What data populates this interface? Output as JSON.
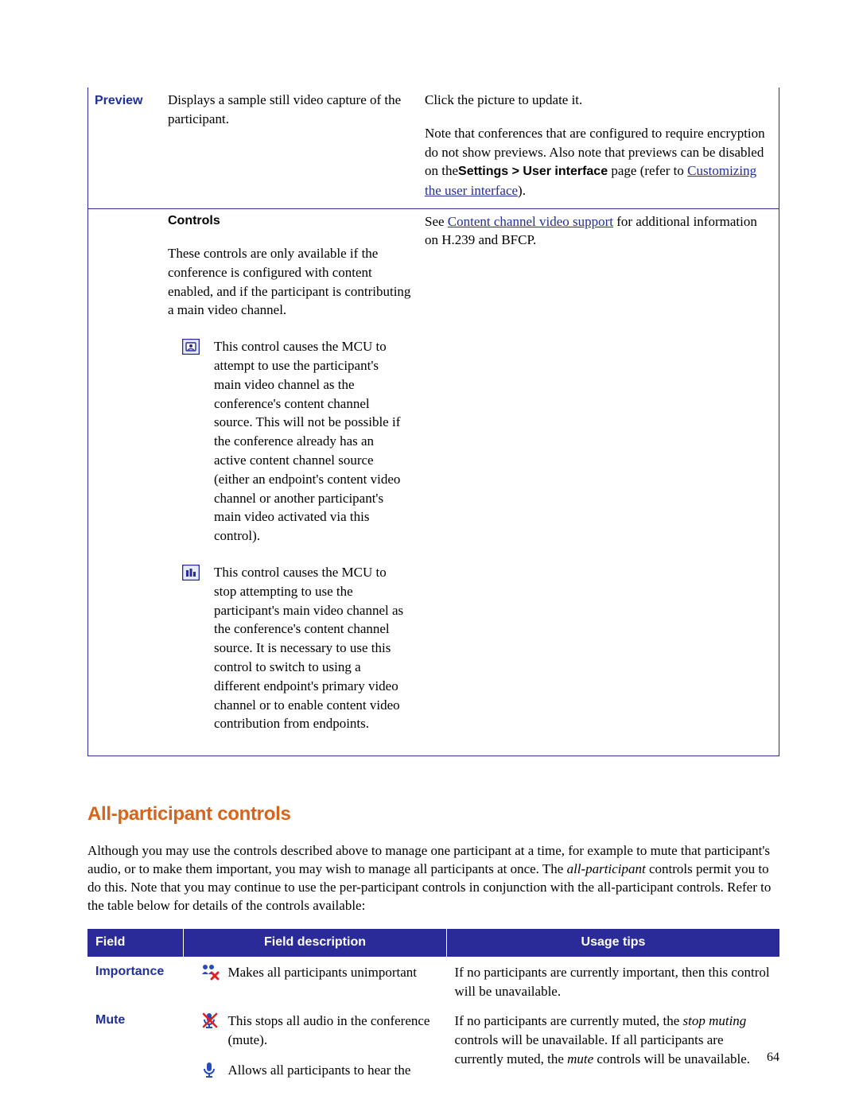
{
  "table1": {
    "preview": {
      "label": "Preview",
      "desc": "Displays a sample still video capture of the participant.",
      "tip1": "Click the picture to update it.",
      "tip2a": "Note that conferences that are configured to require encryption do not show previews. Also note that previews can be disabled on the",
      "tip2b": "Settings > User interface",
      "tip2c": " page (refer to ",
      "tip_link": "Customizing the user interface",
      "tip2d": ")."
    },
    "controls": {
      "label": "Controls",
      "desc": "These controls are only available if the conference is configured with content enabled, and if the participant is contributing a main video channel.",
      "tip_a": "See ",
      "tip_link": "Content channel video support",
      "tip_b": " for additional information on H.239 and BFCP.",
      "item1": "This control causes the MCU to attempt to use the participant's main video channel as the conference's content channel source. This will not be possible if the conference already has an active content channel source (either an endpoint's content video channel or another participant's main video activated via this control).",
      "item2": "This control causes the MCU to stop attempting to use the participant's main video channel as the conference's content channel source. It is necessary to use this control to switch to using a different endpoint's primary video channel or to enable content video contribution from endpoints."
    }
  },
  "section": {
    "title": "All-participant controls",
    "para_a": "Although you may use the controls described above to manage one participant at a time, for example to mute that participant's audio, or to make them important, you may wish to manage all participants at once. The ",
    "para_em": "all-participant",
    "para_b": " controls permit you to do this. Note that you may continue to use the per-participant controls in conjunction with the all-participant controls. Refer to the table below for details of the controls available:"
  },
  "table2": {
    "headers": {
      "c1": "Field",
      "c2": "Field description",
      "c3": "Usage tips"
    },
    "importance": {
      "label": "Importance",
      "desc": "Makes all participants unimportant",
      "tip": "If no participants are currently important, then this control will be unavailable."
    },
    "mute": {
      "label": "Mute",
      "desc1": "This stops all audio in the conference (mute).",
      "desc2": "Allows all participants to hear the",
      "tip_a": "If no participants are currently muted, the ",
      "tip_em1": "stop muting",
      "tip_b": " controls will be unavailable. If all participants are currently muted, the ",
      "tip_em2": "mute",
      "tip_c": " controls will be unavailable."
    }
  },
  "page_number": "64"
}
